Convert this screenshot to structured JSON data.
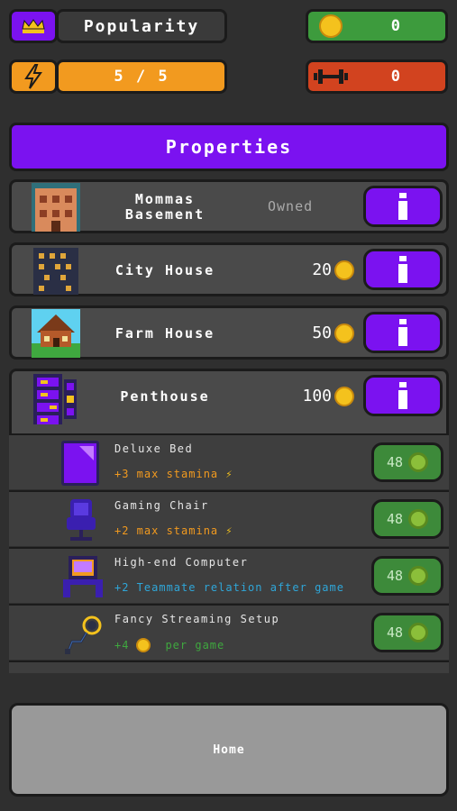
{
  "top": {
    "popularity_label": "Popularity",
    "coins_value": "0",
    "energy_value": "5 / 5",
    "strength_value": "0"
  },
  "header": {
    "title": "Properties"
  },
  "properties": [
    {
      "name": "Mommas\nBasement",
      "status": "Owned"
    },
    {
      "name": "City House",
      "price": "20"
    },
    {
      "name": "Farm House",
      "price": "50"
    },
    {
      "name": "Penthouse",
      "price": "100"
    }
  ],
  "items": [
    {
      "name": "Deluxe Bed",
      "effect": "+3 max stamina",
      "price": "48"
    },
    {
      "name": "Gaming Chair",
      "effect": "+2 max stamina",
      "price": "48"
    },
    {
      "name": "High-end Computer",
      "effect": "+2 Teammate relation after game",
      "price": "48"
    },
    {
      "name": "Fancy Streaming Setup",
      "effect_prefix": "+4",
      "effect_suffix": "per game",
      "price": "48"
    }
  ],
  "nav": {
    "home_label": "Home"
  },
  "colors": {
    "purple": "#7b12f0",
    "green": "#3d8a3a",
    "orange": "#f29a1f",
    "red": "#d2431f"
  }
}
